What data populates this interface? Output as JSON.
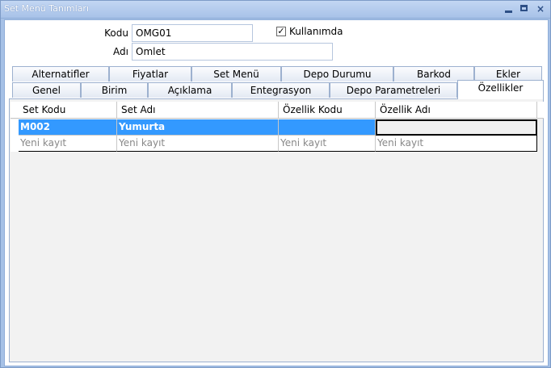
{
  "window": {
    "title": "Set Menü Tanımları",
    "controls": {
      "minimize": "minimize-icon",
      "maximize": "maximize-icon",
      "close": "×"
    }
  },
  "form": {
    "code_label": "Kodu",
    "code_value": "OMG01",
    "name_label": "Adı",
    "name_value": "Omlet",
    "active_label": "Kullanımda",
    "active_checked": true,
    "check_mark": "✓"
  },
  "tabs_row1": [
    "Alternatifler",
    "Fiyatlar",
    "Set Menü",
    "Depo Durumu",
    "Barkod",
    "Ekler"
  ],
  "tabs_row2": [
    "Genel",
    "Birim",
    "Açıklama",
    "Entegrasyon",
    "Depo Parametreleri",
    "Özellikler"
  ],
  "active_tab": "Özellikler",
  "grid": {
    "columns": [
      "Set Kodu",
      "Set Adı",
      "Özellik Kodu",
      "Özellik Adı"
    ],
    "rows": [
      [
        "M002",
        "Yumurta",
        "",
        ""
      ]
    ],
    "new_row": [
      "Yeni kayıt",
      "Yeni kayıt",
      "Yeni kayıt",
      "Yeni kayıt"
    ]
  },
  "colors": {
    "title_bg": "#a6c1e6",
    "selection": "#3399ff",
    "placeholder_text": "#888888"
  }
}
